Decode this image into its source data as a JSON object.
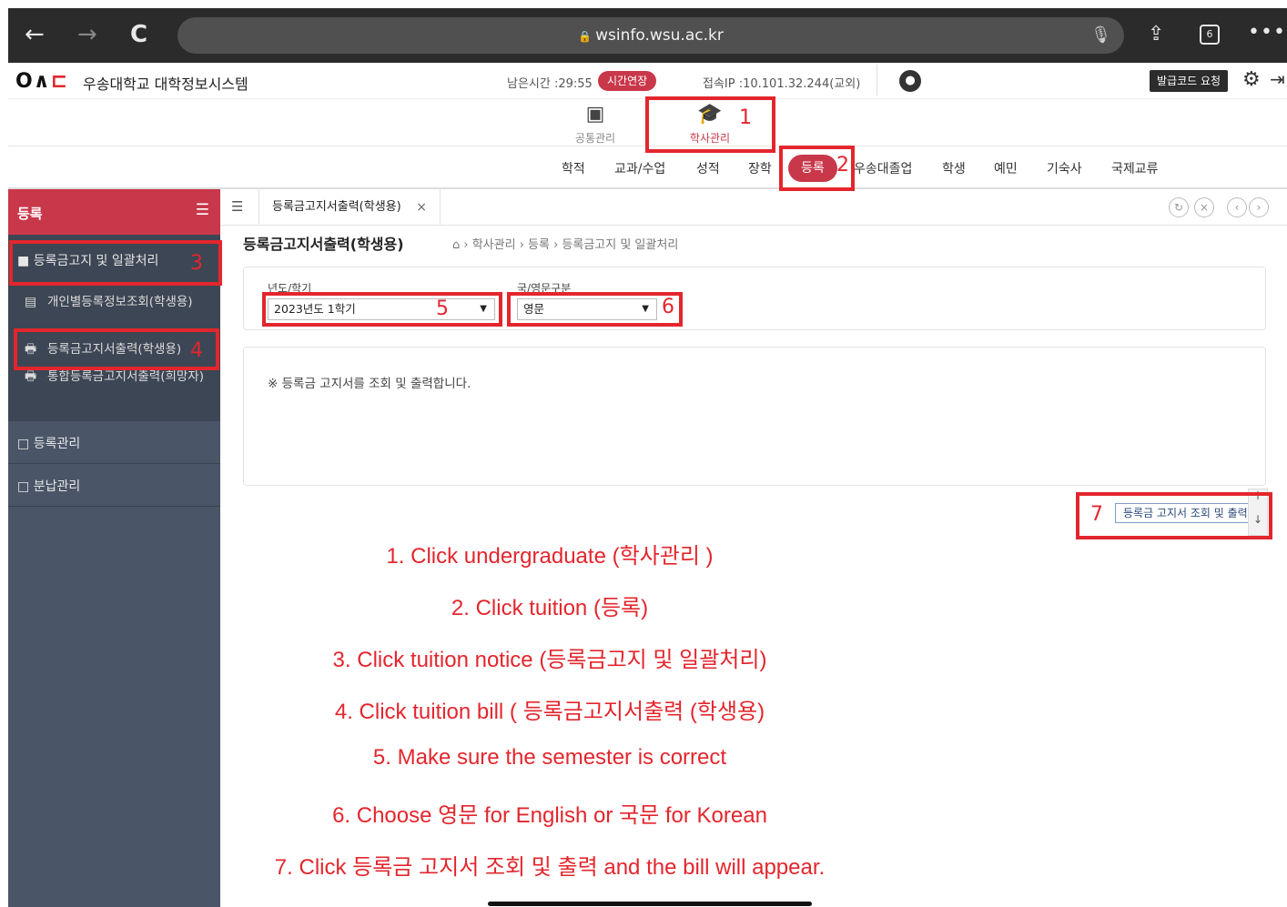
{
  "browser": {
    "back": "←",
    "forward": "→",
    "reload": "C",
    "url": "wsinfo.wsu.ac.kr",
    "tab_count": "6",
    "more": "•••"
  },
  "header": {
    "logo": "OAC",
    "system_name": "우송대학교 대학정보시스템",
    "remaining_time": "남은시간 :29:55",
    "extend_label": "시간연장",
    "ip_info": "접속IP :10.101.32.244(교외)",
    "barcode_label": "발급코드 요청"
  },
  "top_menu": [
    {
      "label": "공통관리",
      "icon": "grid-icon"
    },
    {
      "label": "학사관리",
      "icon": "graduation-cap-icon"
    }
  ],
  "sub_menu": [
    "학적",
    "교과/수업",
    "성적",
    "장학",
    "등록",
    "우송대졸업",
    "학생",
    "예민",
    "기숙사",
    "국제교류"
  ],
  "sidebar": {
    "title": "등록",
    "open_folder": "등록금고지 및 일괄처리",
    "sub_items": [
      "개인별등록정보조회(학생용)",
      "등록금고지서출력(학생용)",
      "통합등록금고지서출력(희망자)"
    ],
    "folders": [
      "등록관리",
      "분납관리"
    ]
  },
  "tab": {
    "label": "등록금고지서출력(학생용)",
    "close": "×"
  },
  "page": {
    "title": "등록금고지서출력(학생용)",
    "breadcrumb": "› 학사관리 › 등록 › 등록금고지 및 일괄처리"
  },
  "form": {
    "year_label": "년도/학기",
    "year_value": "2023년도 1학기",
    "lang_label": "국/영문구분",
    "lang_value": "영문"
  },
  "info_text": "※ 등록금 고지서를 조회 및 출력합니다.",
  "print_button": "등록금 고지서 조회 및 출력",
  "markers": [
    "1",
    "2",
    "3",
    "4",
    "5",
    "6",
    "7"
  ],
  "instructions": [
    "1. Click undergraduate (학사관리 )",
    "2. Click tuition (등록)",
    "3. Click tuition notice (등록금고지 및 일괄처리)",
    "4. Click tuition bill ( 등록금고지서출력 (학생용)",
    "5. Make sure the semester is correct",
    "6. Choose 영문 for English or 국문 for Korean",
    "7. Click 등록금 고지서 조회 및 출력 and the bill will appear."
  ],
  "colors": {
    "accent": "#c8384a",
    "annotation": "#e3262d",
    "sidebar": "#4a5568"
  }
}
